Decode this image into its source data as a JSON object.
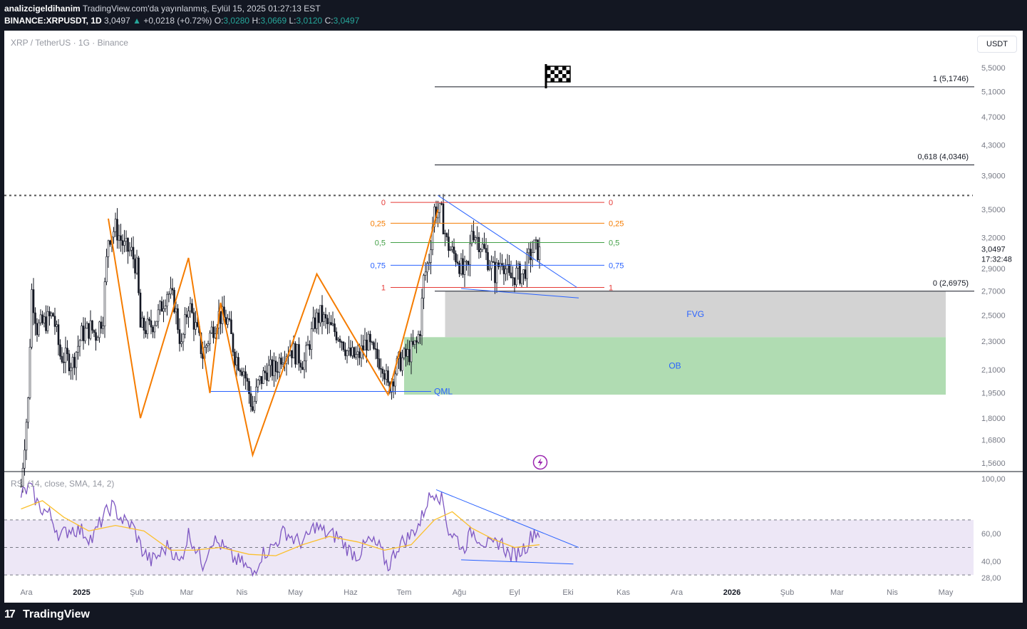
{
  "header": {
    "author": "analizcigeldihanim",
    "published": "TradingView.com'da yayınlanmış, Eylül 15, 2025 01:27:13 EST",
    "symbol_line": "BINANCE:XRPUSDT, 1D",
    "price": "3,0497",
    "change": "+0,0218 (+0.72%)",
    "o_label": "O:",
    "o": "3,0280",
    "h_label": "H:",
    "h": "3,0669",
    "l_label": "L:",
    "l": "3,0120",
    "c_label": "C:",
    "c": "3,0497"
  },
  "chart": {
    "title": "XRP / TetherUS · 1G · Binance",
    "currency_button": "USDT",
    "current_price_label": "3,0497",
    "countdown": "17:32:48",
    "rsi_label": "RSI (14, close, SMA, 14, 2)",
    "colors": {
      "candle": "#131722",
      "zigzag": "#f57c00",
      "trend": "#2962ff",
      "fvg": "#d3d3d3",
      "ob": "#b0dcb2",
      "rsi": "#7e57c2",
      "rsi_ma": "#fbc02d",
      "rsi_band": "#ede7f6"
    }
  },
  "footer": {
    "brand": "TradingView"
  },
  "chart_data": [
    {
      "type": "candlestick",
      "title": "XRP / TetherUS · 1G · Binance",
      "price_scale": "log",
      "ylim": [
        1.5,
        5.8
      ],
      "y_ticks": [
        "5,5000",
        "5,1000",
        "4,7000",
        "4,3000",
        "3,9000",
        "3,5000",
        "3,2000",
        "2,9000",
        "2,7000",
        "2,5000",
        "2,3000",
        "2,1000",
        "1,9500",
        "1,8000",
        "1,6800",
        "1,5600"
      ],
      "y_tick_values": [
        5.5,
        5.1,
        4.7,
        4.3,
        3.9,
        3.5,
        3.2,
        2.9,
        2.7,
        2.5,
        2.3,
        2.1,
        1.95,
        1.8,
        1.68,
        1.56
      ],
      "x_ticks": [
        "Ara",
        "2025",
        "Şub",
        "Mar",
        "Nis",
        "May",
        "Haz",
        "Tem",
        "Ağu",
        "Eyl",
        "Eki",
        "Kas",
        "Ara",
        "2026",
        "Şub",
        "Mar",
        "Nis",
        "May"
      ],
      "x_tick_dates": [
        "2024-12-01",
        "2025-01-01",
        "2025-02-01",
        "2025-03-01",
        "2025-04-01",
        "2025-05-01",
        "2025-06-01",
        "2025-07-01",
        "2025-08-01",
        "2025-09-01",
        "2025-10-01",
        "2025-11-01",
        "2025-12-01",
        "2026-01-01",
        "2026-02-01",
        "2026-03-01",
        "2026-04-01",
        "2026-05-01"
      ],
      "close_path": [
        [
          "2024-11-28",
          1.45
        ],
        [
          "2024-12-02",
          1.9
        ],
        [
          "2024-12-04",
          2.7
        ],
        [
          "2024-12-07",
          2.4
        ],
        [
          "2024-12-12",
          2.45
        ],
        [
          "2024-12-16",
          2.5
        ],
        [
          "2024-12-20",
          2.2
        ],
        [
          "2024-12-27",
          2.15
        ],
        [
          "2025-01-01",
          2.35
        ],
        [
          "2025-01-06",
          2.4
        ],
        [
          "2025-01-09",
          2.35
        ],
        [
          "2025-01-13",
          2.5
        ],
        [
          "2025-01-16",
          3.2
        ],
        [
          "2025-01-20",
          3.3
        ],
        [
          "2025-01-25",
          3.1
        ],
        [
          "2025-01-29",
          3.05
        ],
        [
          "2025-02-01",
          2.9
        ],
        [
          "2025-02-03",
          2.4
        ],
        [
          "2025-02-08",
          2.4
        ],
        [
          "2025-02-13",
          2.5
        ],
        [
          "2025-02-18",
          2.7
        ],
        [
          "2025-02-22",
          2.6
        ],
        [
          "2025-02-26",
          2.25
        ],
        [
          "2025-03-02",
          2.6
        ],
        [
          "2025-03-05",
          2.45
        ],
        [
          "2025-03-10",
          2.2
        ],
        [
          "2025-03-14",
          2.35
        ],
        [
          "2025-03-19",
          2.5
        ],
        [
          "2025-03-24",
          2.45
        ],
        [
          "2025-03-28",
          2.2
        ],
        [
          "2025-04-02",
          2.1
        ],
        [
          "2025-04-07",
          1.85
        ],
        [
          "2025-04-10",
          2.0
        ],
        [
          "2025-04-15",
          2.1
        ],
        [
          "2025-04-20",
          2.1
        ],
        [
          "2025-04-23",
          2.2
        ],
        [
          "2025-04-28",
          2.25
        ],
        [
          "2025-05-02",
          2.2
        ],
        [
          "2025-05-06",
          2.15
        ],
        [
          "2025-05-12",
          2.45
        ],
        [
          "2025-05-15",
          2.5
        ],
        [
          "2025-05-20",
          2.4
        ],
        [
          "2025-05-26",
          2.35
        ],
        [
          "2025-05-31",
          2.2
        ],
        [
          "2025-06-05",
          2.18
        ],
        [
          "2025-06-10",
          2.3
        ],
        [
          "2025-06-14",
          2.2
        ],
        [
          "2025-06-19",
          2.15
        ],
        [
          "2025-06-22",
          1.98
        ],
        [
          "2025-06-28",
          2.15
        ],
        [
          "2025-07-03",
          2.2
        ],
        [
          "2025-07-08",
          2.28
        ],
        [
          "2025-07-10",
          2.4
        ],
        [
          "2025-07-12",
          2.8
        ],
        [
          "2025-07-15",
          3.0
        ],
        [
          "2025-07-18",
          3.5
        ],
        [
          "2025-07-22",
          3.45
        ],
        [
          "2025-07-25",
          3.15
        ],
        [
          "2025-07-28",
          3.05
        ],
        [
          "2025-07-31",
          3.0
        ],
        [
          "2025-08-03",
          2.85
        ],
        [
          "2025-08-06",
          2.9
        ],
        [
          "2025-08-08",
          3.3
        ],
        [
          "2025-08-11",
          3.2
        ],
        [
          "2025-08-14",
          3.1
        ],
        [
          "2025-08-18",
          2.95
        ],
        [
          "2025-08-21",
          2.85
        ],
        [
          "2025-08-25",
          3.0
        ],
        [
          "2025-08-29",
          2.8
        ],
        [
          "2025-09-02",
          2.85
        ],
        [
          "2025-09-06",
          2.85
        ],
        [
          "2025-09-09",
          3.0
        ],
        [
          "2025-09-12",
          3.1
        ],
        [
          "2025-09-15",
          3.0497
        ]
      ],
      "last": {
        "date": "2025-09-15",
        "open": 3.028,
        "high": 3.0669,
        "low": 3.012,
        "close": 3.0497,
        "change": 0.0218,
        "change_pct": 0.72
      },
      "fib_retracement": [
        {
          "level": "0",
          "price": 3.58
        },
        {
          "level": "0,25",
          "price": 3.35
        },
        {
          "level": "0,5",
          "price": 3.15
        },
        {
          "level": "0,75",
          "price": 2.93
        },
        {
          "level": "1",
          "price": 2.73
        }
      ],
      "targets": [
        {
          "label": "1 (5,1746)",
          "price": 5.1746
        },
        {
          "label": "0,618 (4,0346)",
          "price": 4.0346
        },
        {
          "label": "0 (2,6975)",
          "price": 2.6975
        }
      ],
      "zones": [
        {
          "label": "FVG",
          "from": "2025-07-24",
          "to": "2026-05-01",
          "top": 2.6975,
          "bottom": 2.33
        },
        {
          "label": "OB",
          "from": "2025-07-01",
          "to": "2026-05-01",
          "top": 2.33,
          "bottom": 1.94
        }
      ],
      "qml": {
        "label": "QML",
        "price": 1.96,
        "from": "2025-03-14",
        "to": "2025-07-19"
      },
      "zigzag": [
        [
          "2025-01-16",
          3.4
        ],
        [
          "2025-02-03",
          1.8
        ],
        [
          "2025-03-02",
          3.0
        ],
        [
          "2025-03-14",
          1.95
        ],
        [
          "2025-03-20",
          2.6
        ],
        [
          "2025-04-07",
          1.6
        ],
        [
          "2025-05-13",
          2.85
        ],
        [
          "2025-06-22",
          1.94
        ],
        [
          "2025-07-20",
          3.5
        ]
      ],
      "price_trendlines": [
        {
          "from": [
            "2025-07-20",
            3.66
          ],
          "to": [
            "2025-10-06",
            2.73
          ]
        },
        {
          "from": [
            "2025-08-02",
            2.72
          ],
          "to": [
            "2025-10-07",
            2.64
          ]
        }
      ],
      "ath_dotted_line": 3.66
    },
    {
      "type": "line",
      "title": "RSI (14, close, SMA, 14, 2)",
      "ylim": [
        25,
        100
      ],
      "y_ticks": [
        "100,00",
        "60,00",
        "40,00",
        "28,00"
      ],
      "y_tick_values": [
        100,
        60,
        40,
        28
      ],
      "bands": [
        70,
        50,
        30
      ],
      "series": [
        {
          "name": "RSI",
          "points": [
            [
              "2024-11-28",
              88
            ],
            [
              "2024-12-03",
              94
            ],
            [
              "2024-12-08",
              80
            ],
            [
              "2024-12-14",
              74
            ],
            [
              "2024-12-20",
              58
            ],
            [
              "2024-12-26",
              64
            ],
            [
              "2025-01-01",
              62
            ],
            [
              "2025-01-07",
              56
            ],
            [
              "2025-01-13",
              72
            ],
            [
              "2025-01-18",
              80
            ],
            [
              "2025-01-24",
              70
            ],
            [
              "2025-01-30",
              65
            ],
            [
              "2025-02-04",
              48
            ],
            [
              "2025-02-09",
              40
            ],
            [
              "2025-02-14",
              45
            ],
            [
              "2025-02-19",
              52
            ],
            [
              "2025-02-25",
              38
            ],
            [
              "2025-03-02",
              60
            ],
            [
              "2025-03-06",
              50
            ],
            [
              "2025-03-10",
              38
            ],
            [
              "2025-03-15",
              56
            ],
            [
              "2025-03-20",
              52
            ],
            [
              "2025-03-27",
              42
            ],
            [
              "2025-04-02",
              38
            ],
            [
              "2025-04-07",
              30
            ],
            [
              "2025-04-12",
              45
            ],
            [
              "2025-04-18",
              50
            ],
            [
              "2025-04-25",
              62
            ],
            [
              "2025-05-01",
              55
            ],
            [
              "2025-05-06",
              54
            ],
            [
              "2025-05-12",
              66
            ],
            [
              "2025-05-18",
              60
            ],
            [
              "2025-05-25",
              58
            ],
            [
              "2025-05-31",
              48
            ],
            [
              "2025-06-05",
              44
            ],
            [
              "2025-06-11",
              55
            ],
            [
              "2025-06-17",
              50
            ],
            [
              "2025-06-22",
              36
            ],
            [
              "2025-06-28",
              52
            ],
            [
              "2025-07-04",
              58
            ],
            [
              "2025-07-10",
              68
            ],
            [
              "2025-07-14",
              84
            ],
            [
              "2025-07-19",
              92
            ],
            [
              "2025-07-23",
              82
            ],
            [
              "2025-07-26",
              62
            ],
            [
              "2025-07-31",
              56
            ],
            [
              "2025-08-03",
              48
            ],
            [
              "2025-08-08",
              62
            ],
            [
              "2025-08-13",
              56
            ],
            [
              "2025-08-19",
              50
            ],
            [
              "2025-08-24",
              55
            ],
            [
              "2025-08-29",
              44
            ],
            [
              "2025-09-03",
              46
            ],
            [
              "2025-09-08",
              52
            ],
            [
              "2025-09-12",
              62
            ],
            [
              "2025-09-15",
              60
            ]
          ]
        },
        {
          "name": "RSI-based MA",
          "points": [
            [
              "2024-11-28",
              78
            ],
            [
              "2024-12-10",
              84
            ],
            [
              "2024-12-22",
              72
            ],
            [
              "2025-01-05",
              62
            ],
            [
              "2025-01-20",
              66
            ],
            [
              "2025-02-05",
              62
            ],
            [
              "2025-02-20",
              48
            ],
            [
              "2025-03-05",
              48
            ],
            [
              "2025-03-20",
              50
            ],
            [
              "2025-04-05",
              45
            ],
            [
              "2025-04-20",
              44
            ],
            [
              "2025-05-05",
              52
            ],
            [
              "2025-05-20",
              58
            ],
            [
              "2025-06-05",
              54
            ],
            [
              "2025-06-20",
              48
            ],
            [
              "2025-07-05",
              52
            ],
            [
              "2025-07-18",
              70
            ],
            [
              "2025-07-28",
              76
            ],
            [
              "2025-08-08",
              64
            ],
            [
              "2025-08-20",
              56
            ],
            [
              "2025-09-01",
              50
            ],
            [
              "2025-09-15",
              52
            ]
          ]
        }
      ],
      "rsi_trendlines": [
        {
          "from": [
            "2025-07-19",
            92
          ],
          "to": [
            "2025-10-07",
            50
          ]
        },
        {
          "from": [
            "2025-08-02",
            41
          ],
          "to": [
            "2025-10-04",
            38
          ]
        }
      ]
    }
  ]
}
